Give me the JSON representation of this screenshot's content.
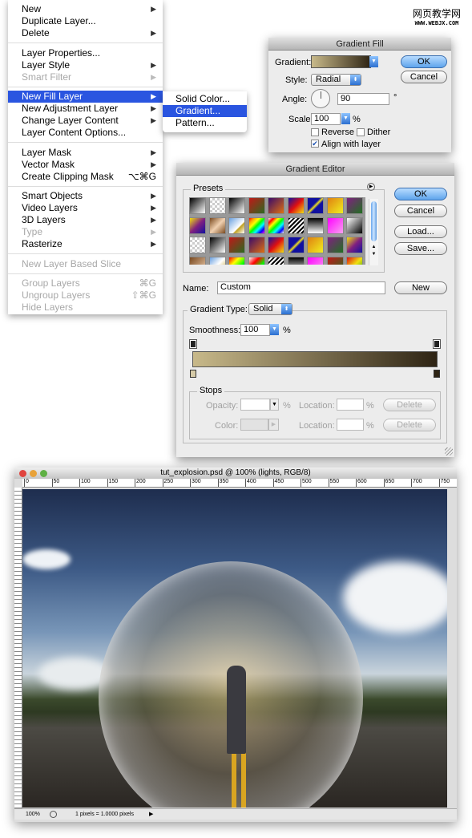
{
  "watermark": {
    "cn": "网页教学网",
    "url": "WWW.WEBJX.COM"
  },
  "menu": {
    "items": [
      {
        "label": "New",
        "sub": true
      },
      {
        "label": "Duplicate Layer..."
      },
      {
        "label": "Delete",
        "sub": true
      },
      {
        "label": "Layer Properties..."
      },
      {
        "label": "Layer Style",
        "sub": true
      },
      {
        "label": "Smart Filter",
        "sub": true,
        "disabled": true
      },
      {
        "label": "New Fill Layer",
        "sub": true,
        "selected": true
      },
      {
        "label": "New Adjustment Layer",
        "sub": true
      },
      {
        "label": "Change Layer Content",
        "sub": true
      },
      {
        "label": "Layer Content Options..."
      },
      {
        "label": "Layer Mask",
        "sub": true
      },
      {
        "label": "Vector Mask",
        "sub": true
      },
      {
        "label": "Create Clipping Mask",
        "shortcut": "⌥⌘G"
      },
      {
        "label": "Smart Objects",
        "sub": true
      },
      {
        "label": "Video Layers",
        "sub": true
      },
      {
        "label": "3D Layers",
        "sub": true
      },
      {
        "label": "Type",
        "sub": true,
        "disabled": true
      },
      {
        "label": "Rasterize",
        "sub": true
      },
      {
        "label": "New Layer Based Slice",
        "disabled": true
      },
      {
        "label": "Group Layers",
        "shortcut": "⌘G",
        "disabled": true
      },
      {
        "label": "Ungroup Layers",
        "shortcut": "⇧⌘G",
        "disabled": true
      },
      {
        "label": "Hide Layers",
        "disabled": true
      }
    ]
  },
  "submenu": {
    "items": [
      "Solid Color...",
      "Gradient...",
      "Pattern..."
    ],
    "selected": 1
  },
  "gradient_fill": {
    "title": "Gradient Fill",
    "gradient_label": "Gradient:",
    "style_label": "Style:",
    "style": "Radial",
    "angle_label": "Angle:",
    "angle": "90",
    "degree": "°",
    "scale_label": "Scale:",
    "scale": "100",
    "pct": "%",
    "reverse": "Reverse",
    "reverse_checked": false,
    "dither": "Dither",
    "dither_checked": false,
    "align": "Align with layer",
    "align_checked": true,
    "ok": "OK",
    "cancel": "Cancel",
    "colors": [
      "#c8b98a",
      "#2e2414"
    ]
  },
  "gradient_editor": {
    "title": "Gradient Editor",
    "presets_label": "Presets",
    "ok": "OK",
    "cancel": "Cancel",
    "load": "Load...",
    "save": "Save...",
    "name_label": "Name:",
    "name": "Custom",
    "new": "New",
    "type_label": "Gradient Type:",
    "type": "Solid",
    "smooth_label": "Smoothness:",
    "smoothness": "100",
    "pct": "%",
    "stops_label": "Stops",
    "opacity_label": "Opacity:",
    "color_label": "Color:",
    "location_label": "Location:",
    "delete": "Delete"
  },
  "document": {
    "title": "tut_explosion.psd @ 100% (lights, RGB/8)",
    "ruler": [
      "0",
      "50",
      "100",
      "150",
      "200",
      "250",
      "300",
      "350",
      "400",
      "450",
      "500",
      "550",
      "600",
      "650",
      "700",
      "750"
    ],
    "zoom": "100%",
    "status": "1 pixels = 1.0000 pixels"
  }
}
